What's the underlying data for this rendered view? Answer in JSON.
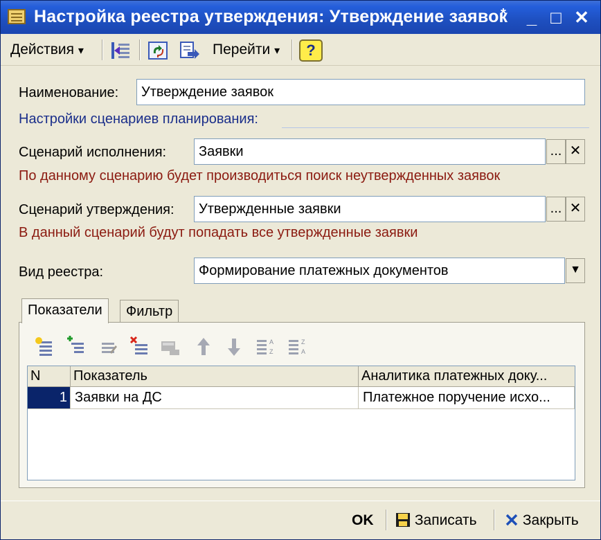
{
  "window": {
    "title": "Настройка реестра утверждения: Утверждение заявок",
    "modified_marker": "*",
    "minimize_glyph": "_",
    "maximize_glyph": "□",
    "close_glyph": "✕"
  },
  "toolbar": {
    "actions_label": "Действия",
    "goto_label": "Перейти",
    "help_label": "?",
    "dropdown_glyph": "▾"
  },
  "form": {
    "name_label": "Наименование:",
    "name_value": "Утверждение заявок",
    "planning_settings_label": "Настройки сценариев планирования:",
    "exec_scenario_label": "Сценарий исполнения:",
    "exec_scenario_value": "Заявки",
    "exec_scenario_hint": "По данному сценарию будет производиться поиск неутвержденных заявок",
    "approve_scenario_label": "Сценарий утверждения:",
    "approve_scenario_value": "Утвержденные заявки",
    "approve_scenario_hint": "В данный сценарий будут попадать все утвержденные заявки",
    "registry_type_label": "Вид реестра:",
    "registry_type_value": "Формирование платежных документов",
    "select_glyph": "...",
    "clear_glyph": "✕",
    "dropdown_glyph": "▼"
  },
  "tabs": [
    {
      "label": "Показатели",
      "active": true
    },
    {
      "label": "Фильтр",
      "active": false
    }
  ],
  "grid": {
    "columns": [
      "N",
      "Показатель",
      "Аналитика платежных доку..."
    ],
    "rows": [
      {
        "n": "1",
        "indicator": "Заявки на ДС",
        "analytics": "Платежное поручение исхо..."
      }
    ]
  },
  "grid_toolbar_icons": [
    "add-icon",
    "add-child-icon",
    "edit-icon",
    "delete-icon",
    "copy-icon",
    "move-up-icon",
    "move-down-icon",
    "sort-asc-icon",
    "sort-desc-icon"
  ],
  "footer": {
    "ok_label": "OK",
    "save_label": "Записать",
    "close_label": "Закрыть"
  },
  "colors": {
    "title_bar": "#245edb",
    "hint_red": "#8b1a10",
    "link_blue": "#1a2e8a",
    "selection": "#0a246a"
  }
}
